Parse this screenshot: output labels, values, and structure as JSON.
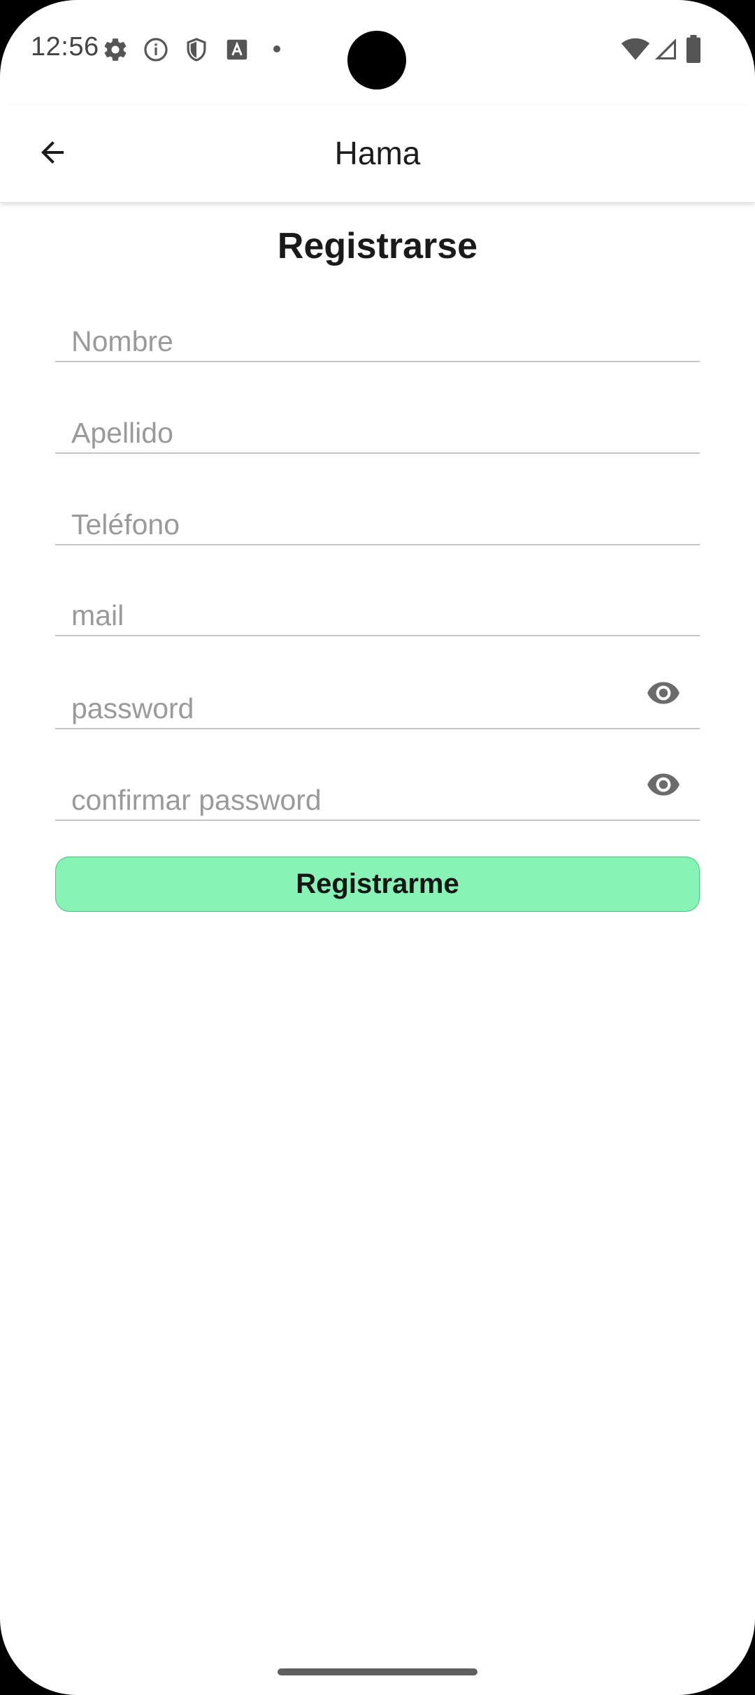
{
  "status_bar": {
    "time": "12:56"
  },
  "app_bar": {
    "title": "Hama"
  },
  "form": {
    "title": "Registrarse",
    "fields": [
      {
        "placeholder": "Nombre",
        "value": ""
      },
      {
        "placeholder": "Apellido",
        "value": ""
      },
      {
        "placeholder": "Teléfono",
        "value": ""
      },
      {
        "placeholder": "mail",
        "value": ""
      },
      {
        "placeholder": "password",
        "value": ""
      },
      {
        "placeholder": "confirmar password",
        "value": ""
      }
    ],
    "submit_label": "Registrarme"
  },
  "colors": {
    "accent": "#87f3b5",
    "accent_border": "#46c47f"
  },
  "icons": [
    "settings-icon",
    "info-icon",
    "shield-icon",
    "font-icon",
    "dot-icon",
    "wifi-icon",
    "signal-icon",
    "battery-icon",
    "back-arrow-icon",
    "eye-icon"
  ]
}
